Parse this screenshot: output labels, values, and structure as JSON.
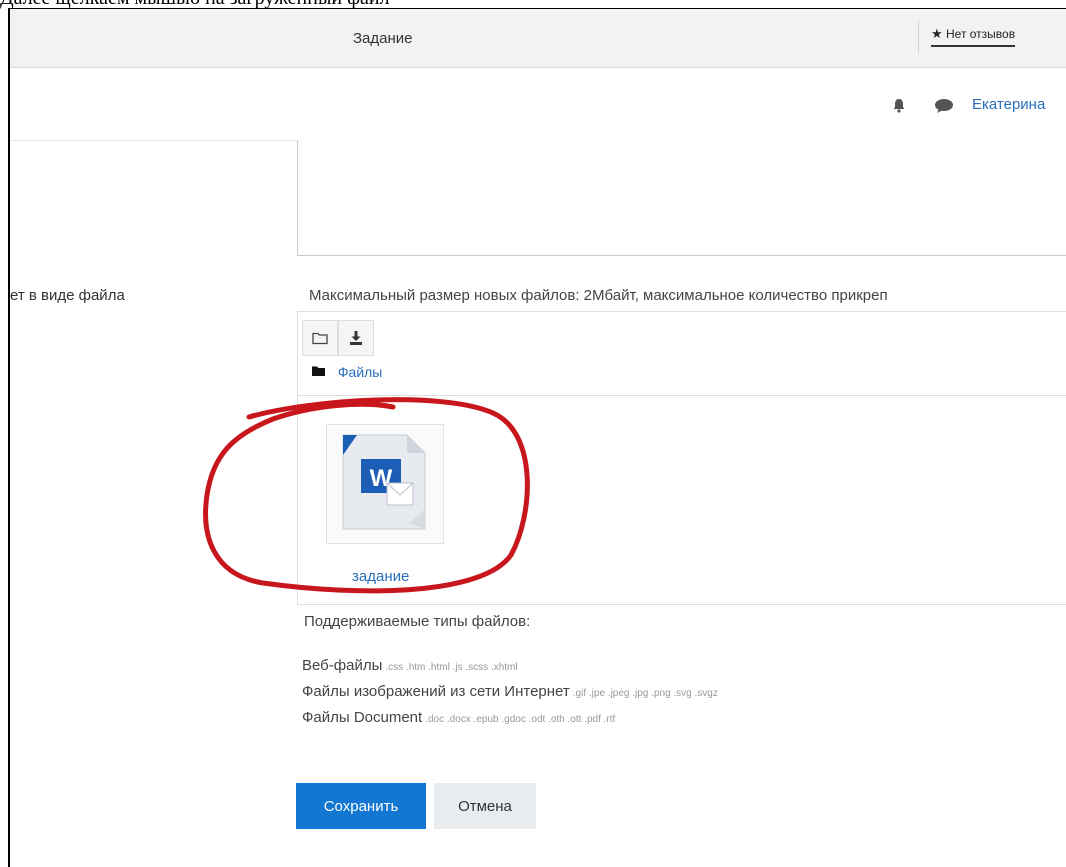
{
  "caption": "Далее щелкаем мышью на загруженный файл",
  "topbar": {
    "title": "Задание",
    "reviews": "Нет отзывов"
  },
  "navbar": {
    "username": "Екатерина"
  },
  "form": {
    "field_label": "ет в виде файла",
    "max_size_note": "Максимальный размер новых файлов: 2Мбайт, максимальное количество прикреп"
  },
  "filepicker": {
    "path_label": "Файлы",
    "file": {
      "name": "задание",
      "icon": "word-document-icon"
    }
  },
  "supported": {
    "title": "Поддерживаемые типы файлов:",
    "types": [
      {
        "label": "Веб-файлы",
        "exts": ".css .htm .html .js .scss .xhtml"
      },
      {
        "label": "Файлы изображений из сети Интернет",
        "exts": ".gif .jpe .jpeg .jpg .png .svg .svgz"
      },
      {
        "label": "Файлы Document",
        "exts": ".doc .docx .epub .gdoc .odt .oth .ott .pdf .rtf"
      }
    ]
  },
  "buttons": {
    "save": "Сохранить",
    "cancel": "Отмена"
  },
  "colors": {
    "accent": "#1177d1",
    "link": "#2a6fbb",
    "highlight": "#c8161d"
  }
}
